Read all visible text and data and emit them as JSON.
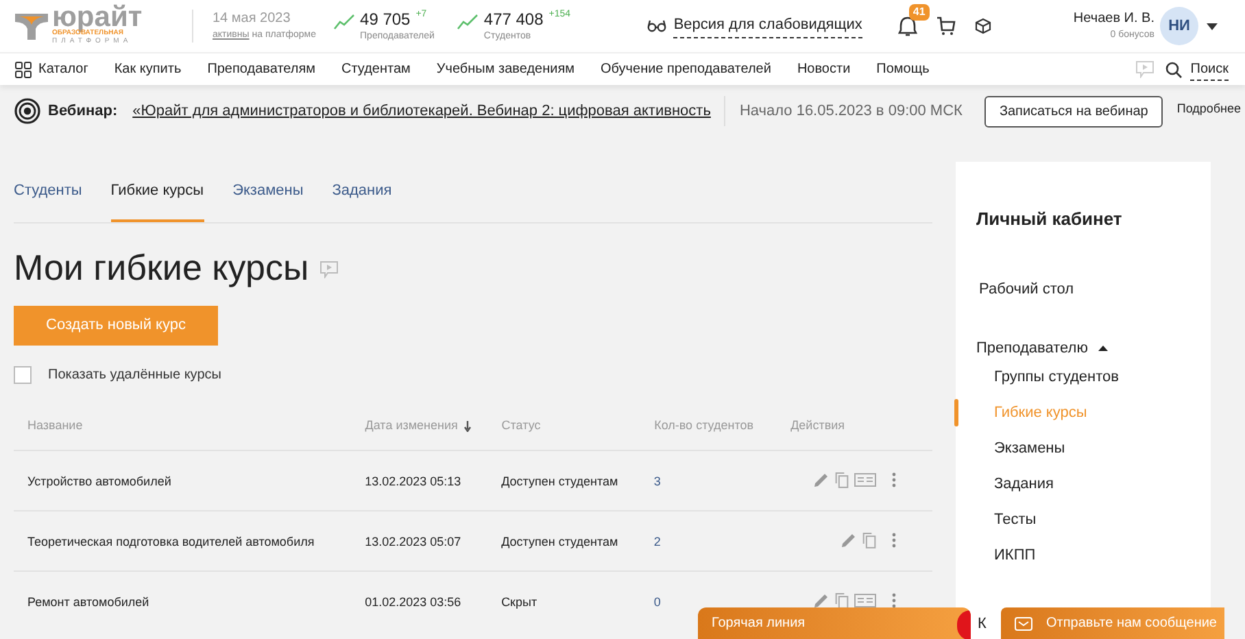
{
  "header": {
    "logo": {
      "name": "юрайт",
      "line_1": "ОБРАЗОВАТЕЛЬНАЯ",
      "line_2": "ПЛАТФОРМА"
    },
    "date": "14 мая 2023",
    "active_link": "активны",
    "active_rest": "на платформе",
    "stats": [
      {
        "value": "49 705",
        "delta": "+7",
        "label": "Преподавателей"
      },
      {
        "value": "477 408",
        "delta": "+154",
        "label": "Студентов"
      }
    ],
    "accessibility": "Версия для слабовидящих",
    "notifications": "41",
    "user": {
      "name": "Нечаев И. В.",
      "bonus": "0 бонусов",
      "initials": "НИ"
    }
  },
  "nav": {
    "items": [
      "Каталог",
      "Как купить",
      "Преподавателям",
      "Студентам",
      "Учебным заведениям",
      "Обучение преподавателей",
      "Новости",
      "Помощь"
    ],
    "search": "Поиск"
  },
  "webinar": {
    "label": "Вебинар:",
    "title": "«Юрайт для администраторов и библиотекарей. Вебинар 2: цифровая активность",
    "start": "Начало 16.05.2023 в 09:00 МСК",
    "button": "Записаться на вебинар",
    "more": "Подробнее"
  },
  "tabs": [
    {
      "label": "Студенты",
      "selected": false
    },
    {
      "label": "Гибкие курсы",
      "selected": true
    },
    {
      "label": "Экзамены",
      "selected": false
    },
    {
      "label": "Задания",
      "selected": false
    }
  ],
  "page_title": "Мои гибкие курсы",
  "create_button": "Создать новый курс",
  "show_deleted": {
    "label": "Показать удалённые курсы",
    "checked": false
  },
  "table": {
    "columns": [
      "Название",
      "Дата изменения",
      "Статус",
      "Кол-во студентов",
      "Действия"
    ],
    "rows": [
      {
        "name": "Устройство автомобилей",
        "date": "13.02.2023 05:13",
        "status": "Доступен студентам",
        "students": "3",
        "has_preview": true
      },
      {
        "name": "Теоретическая подготовка водителей автомобиля",
        "date": "13.02.2023 05:07",
        "status": "Доступен студентам",
        "students": "2",
        "has_preview": false
      },
      {
        "name": "Ремонт автомобилей",
        "date": "01.02.2023 03:56",
        "status": "Скрыт",
        "students": "0",
        "has_preview": true
      }
    ]
  },
  "sidebar": {
    "title": "Личный кабинет",
    "items": [
      {
        "label": "Рабочий стол"
      },
      {
        "label": "Преподавателю",
        "expanded": true,
        "children": [
          {
            "label": "Группы студентов",
            "selected": false
          },
          {
            "label": "Гибкие курсы",
            "selected": true
          },
          {
            "label": "Экзамены",
            "selected": false
          },
          {
            "label": "Задания",
            "selected": false
          },
          {
            "label": "Тесты",
            "selected": false
          },
          {
            "label": "ИКПП",
            "selected": false
          }
        ]
      },
      {
        "label": "К"
      }
    ]
  },
  "hotline": "Горячая линия",
  "message_button": "Отправьте нам сообщение"
}
